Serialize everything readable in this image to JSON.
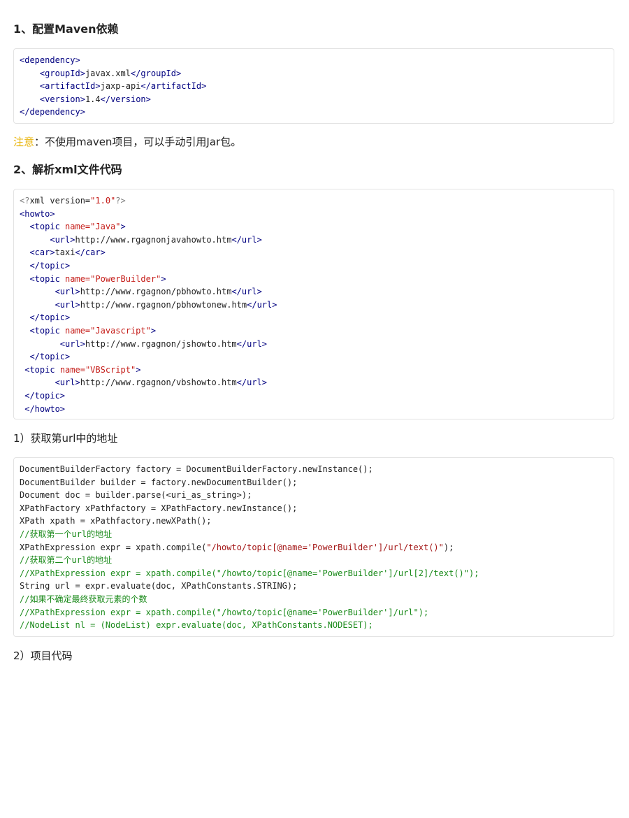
{
  "section1": {
    "heading": "1、配置Maven依赖",
    "maven_lines": [
      {
        "indent": "",
        "open": "<dependency>",
        "text": "",
        "close": ""
      },
      {
        "indent": "    ",
        "open": "<groupId>",
        "text": "javax.xml",
        "close": "</groupId>"
      },
      {
        "indent": "    ",
        "open": "<artifactId>",
        "text": "jaxp-api",
        "close": "</artifactId>"
      },
      {
        "indent": "    ",
        "open": "<version>",
        "text": "1.4",
        "close": "</version>"
      },
      {
        "indent": "",
        "open": "</dependency>",
        "text": "",
        "close": ""
      }
    ]
  },
  "note": {
    "label": "注意",
    "text": "：不使用maven项目，可以手动引用Jar包。"
  },
  "section2": {
    "heading": "2、解析xml文件代码",
    "xml_prolog": {
      "open": "<?",
      "name": "xml version=",
      "value": "\"1.0\"",
      "close": "?>"
    },
    "xml_lines": [
      {
        "indent": "",
        "kind": "tag",
        "tag": "<howto>"
      },
      {
        "indent": "  ",
        "kind": "topic",
        "tag_open": "<topic ",
        "attr": "name=",
        "val": "\"Java\"",
        "tag_close": ">"
      },
      {
        "indent": "      ",
        "kind": "url",
        "open": "<url>",
        "text": "http://www.rgagnonjavahowto.htm",
        "close": "</url>"
      },
      {
        "indent": "  ",
        "kind": "url",
        "open": "<car>",
        "text": "taxi",
        "close": "</car>"
      },
      {
        "indent": "  ",
        "kind": "tag",
        "tag": "</topic>"
      },
      {
        "indent": "  ",
        "kind": "topic",
        "tag_open": "<topic ",
        "attr": "name=",
        "val": "\"PowerBuilder\"",
        "tag_close": ">"
      },
      {
        "indent": "       ",
        "kind": "url",
        "open": "<url>",
        "text": "http://www.rgagnon/pbhowto.htm",
        "close": "</url>"
      },
      {
        "indent": "       ",
        "kind": "url",
        "open": "<url>",
        "text": "http://www.rgagnon/pbhowtonew.htm",
        "close": "</url>"
      },
      {
        "indent": "  ",
        "kind": "tag",
        "tag": "</topic>"
      },
      {
        "indent": "  ",
        "kind": "topic",
        "tag_open": "<topic ",
        "attr": "name=",
        "val": "\"Javascript\"",
        "tag_close": ">"
      },
      {
        "indent": "        ",
        "kind": "url",
        "open": "<url>",
        "text": "http://www.rgagnon/jshowto.htm",
        "close": "</url>"
      },
      {
        "indent": "  ",
        "kind": "tag",
        "tag": "</topic>"
      },
      {
        "indent": " ",
        "kind": "topic",
        "tag_open": "<topic ",
        "attr": "name=",
        "val": "\"VBScript\"",
        "tag_close": ">"
      },
      {
        "indent": "       ",
        "kind": "url",
        "open": "<url>",
        "text": "http://www.rgagnon/vbshowto.htm",
        "close": "</url>"
      },
      {
        "indent": " ",
        "kind": "tag",
        "tag": "</topic>"
      },
      {
        "indent": " ",
        "kind": "tag",
        "tag": "</howto>"
      }
    ]
  },
  "step1": {
    "title": "1）获取第url中的地址",
    "code_lines": [
      {
        "kind": "code",
        "text": "DocumentBuilderFactory factory = DocumentBuilderFactory.newInstance();"
      },
      {
        "kind": "code",
        "text": "DocumentBuilder builder = factory.newDocumentBuilder();"
      },
      {
        "kind": "code",
        "text": "Document doc = builder.parse(<uri_as_string>);"
      },
      {
        "kind": "code",
        "text": "XPathFactory xPathfactory = XPathFactory.newInstance();"
      },
      {
        "kind": "code",
        "text": "XPath xpath = xPathfactory.newXPath();"
      },
      {
        "kind": "comment",
        "text": "//获取第一个url的地址"
      },
      {
        "kind": "string",
        "before": "XPathExpression expr = xpath.compile(",
        "str": "\"/howto/topic[@name='PowerBuilder']/url/text()\"",
        "after": ");"
      },
      {
        "kind": "comment",
        "text": "//获取第二个url的地址"
      },
      {
        "kind": "comment",
        "text": "//XPathExpression expr = xpath.compile(\"/howto/topic[@name='PowerBuilder']/url[2]/text()\");"
      },
      {
        "kind": "code",
        "text": "String url = expr.evaluate(doc, XPathConstants.STRING);"
      },
      {
        "kind": "comment",
        "text": "//如果不确定最终获取元素的个数"
      },
      {
        "kind": "comment",
        "text": "//XPathExpression expr = xpath.compile(\"/howto/topic[@name='PowerBuilder']/url\");"
      },
      {
        "kind": "comment",
        "text": "//NodeList nl = (NodeList) expr.evaluate(doc, XPathConstants.NODESET);"
      }
    ]
  },
  "step2": {
    "title": "2）项目代码"
  }
}
